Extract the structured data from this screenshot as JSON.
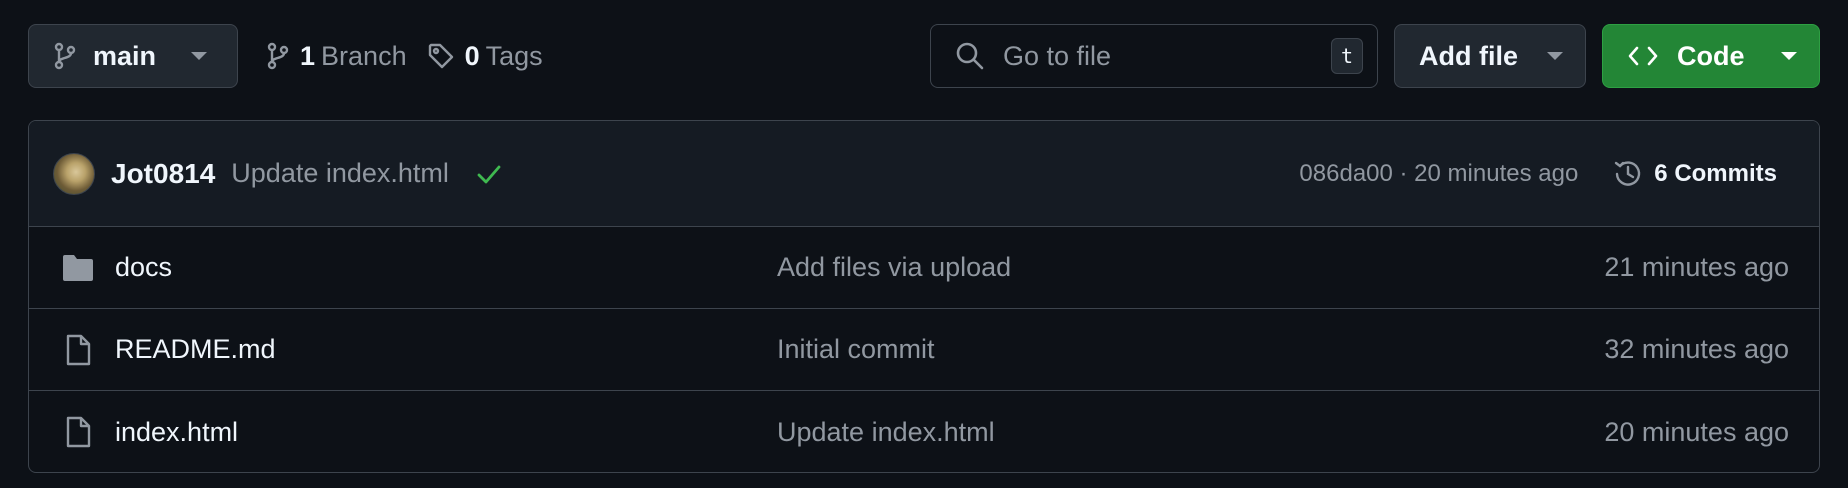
{
  "toolbar": {
    "branch_name": "main",
    "branch_count": "1",
    "branch_label": "Branch",
    "tag_count": "0",
    "tag_label": "Tags",
    "search_placeholder": "Go to file",
    "search_shortcut": "t",
    "add_file_label": "Add file",
    "code_label": "Code"
  },
  "commit": {
    "author": "Jot0814",
    "message": "Update index.html",
    "sha_time": "086da00 · 20 minutes ago",
    "commits_label": "6 Commits"
  },
  "files": [
    {
      "name": "docs",
      "type": "folder",
      "message": "Add files via upload",
      "time": "21 minutes ago"
    },
    {
      "name": "README.md",
      "type": "file",
      "message": "Initial commit",
      "time": "32 minutes ago"
    },
    {
      "name": "index.html",
      "type": "file",
      "message": "Update index.html",
      "time": "20 minutes ago"
    }
  ],
  "colors": {
    "background": "#0d1117",
    "code_button": "#238636",
    "check": "#3fb950"
  }
}
